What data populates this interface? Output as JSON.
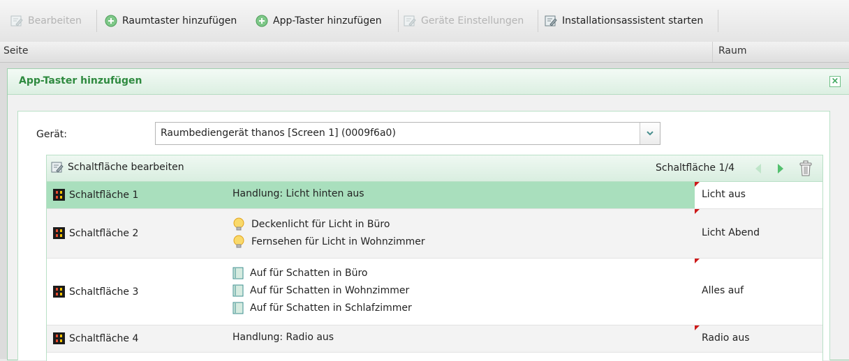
{
  "toolbar": {
    "edit": "Bearbeiten",
    "add_room_button": "Raumtaster hinzufügen",
    "add_app_button": "App-Taster hinzufügen",
    "device_settings": "Geräte Einstellungen",
    "start_wizard": "Installationsassistent starten"
  },
  "header": {
    "col_page": "Seite",
    "col_room": "Raum"
  },
  "dialog": {
    "title": "App-Taster hinzufügen",
    "close": "×",
    "device_label": "Gerät:",
    "device_value": "Raumbediengerät thanos [Screen 1] (0009f6a0)",
    "edit_button": "Schaltfläche bearbeiten",
    "page_indicator": "Schaltfläche 1/4",
    "rows": [
      {
        "name": "Schaltfläche 1",
        "actions": [
          "Handlung: Licht hinten aus"
        ],
        "label": "Licht aus"
      },
      {
        "name": "Schaltfläche 2",
        "actions": [
          "Deckenlicht für Licht in Büro",
          "Fernsehen für Licht in Wohnzimmer"
        ],
        "label": "Licht Abend"
      },
      {
        "name": "Schaltfläche 3",
        "actions": [
          "Auf für Schatten in Büro",
          "Auf für Schatten in Wohnzimmer",
          "Auf für Schatten in Schlafzimmer"
        ],
        "label": "Alles auf"
      },
      {
        "name": "Schaltfläche 4",
        "actions": [
          "Handlung: Radio aus"
        ],
        "label": "Radio aus"
      }
    ]
  },
  "colors": {
    "accent_green": "#2e8a3f",
    "selected_row": "#a9dfbd",
    "flag_red": "#cc1a1a"
  }
}
